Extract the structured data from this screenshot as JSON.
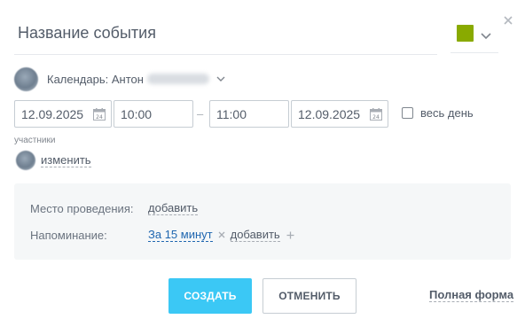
{
  "header": {
    "title_placeholder": "Название события",
    "color": "#89aa00"
  },
  "calendar": {
    "label": "Календарь: Антон"
  },
  "datetime": {
    "start_date": "12.09.2025",
    "start_time": "10:00",
    "separator": "–",
    "end_time": "11:00",
    "end_date": "12.09.2025",
    "calendar_icon_day": "24",
    "all_day_label": "весь день"
  },
  "participants": {
    "title": "участники",
    "change_label": "изменить"
  },
  "options": {
    "location_label": "Место проведения:",
    "location_add": "добавить",
    "reminder_label": "Напоминание:",
    "reminder_value": "За 15 минут",
    "reminder_add": "добавить"
  },
  "footer": {
    "create_label": "СОЗДАТЬ",
    "cancel_label": "ОТМЕНИТЬ",
    "full_form_label": "Полная форма"
  },
  "colors": {
    "accent": "#3bc8f5",
    "link_blue": "#2067b0",
    "text": "#535c69",
    "event_color": "#89aa00"
  }
}
